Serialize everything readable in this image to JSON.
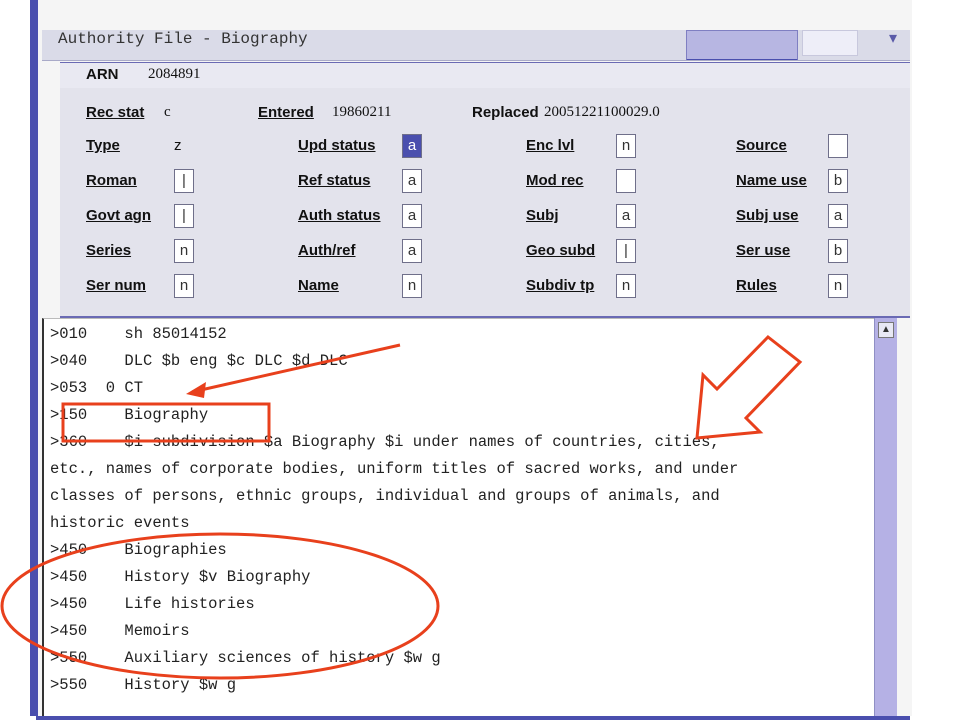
{
  "window": {
    "title": "Authority File - Biography"
  },
  "arn": {
    "label": "ARN",
    "value": "2084891"
  },
  "record": {
    "rec_stat_label": "Rec stat",
    "rec_stat_value": "c",
    "entered_label": "Entered",
    "entered_value": "19860211",
    "replaced_label": "Replaced",
    "replaced_value": "20051221100029.0"
  },
  "fixed_fields": {
    "type_label": "Type",
    "type_value": "z",
    "upd_status_label": "Upd status",
    "upd_status_value": "a",
    "enc_lvl_label": "Enc lvl",
    "enc_lvl_value": "n",
    "source_label": "Source",
    "source_value": "",
    "roman_label": "Roman",
    "roman_value": "|",
    "ref_status_label": "Ref status",
    "ref_status_value": "a",
    "mod_rec_label": "Mod rec",
    "mod_rec_value": "",
    "name_use_label": "Name use",
    "name_use_value": "b",
    "govt_agn_label": "Govt agn",
    "govt_agn_value": "|",
    "auth_status_label": "Auth status",
    "auth_status_value": "a",
    "subj_label": "Subj",
    "subj_value": "a",
    "subj_use_label": "Subj use",
    "subj_use_value": "a",
    "series_label": "Series",
    "series_value": "n",
    "auth_ref_label": "Auth/ref",
    "auth_ref_value": "a",
    "geo_subd_label": "Geo subd",
    "geo_subd_value": "|",
    "ser_use_label": "Ser use",
    "ser_use_value": "b",
    "ser_num_label": "Ser num",
    "ser_num_value": "n",
    "name_label": "Name",
    "name_value": "n",
    "subdiv_tp_label": "Subdiv tp",
    "subdiv_tp_value": "n",
    "rules_label": "Rules",
    "rules_value": "n"
  },
  "marc_lines": [
    ">010    sh 85014152",
    ">040    DLC $b eng $c DLC $d DLC",
    ">053  0 CT",
    ">150    Biography",
    ">360    $i subdivision $a Biography $i under names of countries, cities,",
    "etc., names of corporate bodies, uniform titles of sacred works, and under",
    "classes of persons, ethnic groups, individual and groups of animals, and",
    "historic events",
    ">450    Biographies",
    ">450    History $v Biography",
    ">450    Life histories",
    ">450    Memoirs",
    ">550    Auxiliary sciences of history $w g",
    ">550    History $w g"
  ],
  "colors": {
    "accent": "#4a4fae",
    "annotation": "#e8401c",
    "panel": "#e3e3ec"
  },
  "icons": {
    "scroll_up": "triangle-up"
  }
}
